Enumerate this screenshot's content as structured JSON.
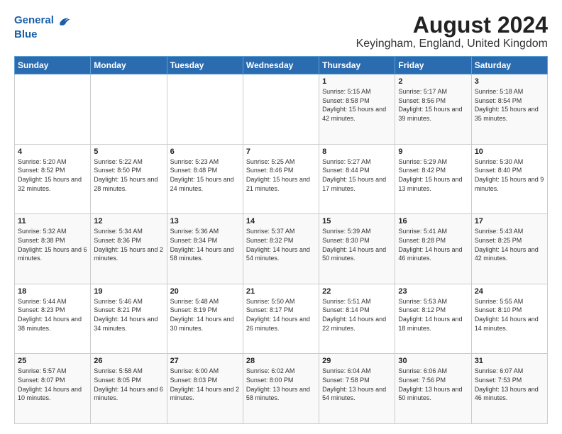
{
  "header": {
    "logo_line1": "General",
    "logo_line2": "Blue",
    "title": "August 2024",
    "subtitle": "Keyingham, England, United Kingdom"
  },
  "weekdays": [
    "Sunday",
    "Monday",
    "Tuesday",
    "Wednesday",
    "Thursday",
    "Friday",
    "Saturday"
  ],
  "weeks": [
    [
      {
        "day": "",
        "sunrise": "",
        "sunset": "",
        "daylight": ""
      },
      {
        "day": "",
        "sunrise": "",
        "sunset": "",
        "daylight": ""
      },
      {
        "day": "",
        "sunrise": "",
        "sunset": "",
        "daylight": ""
      },
      {
        "day": "",
        "sunrise": "",
        "sunset": "",
        "daylight": ""
      },
      {
        "day": "1",
        "sunrise": "Sunrise: 5:15 AM",
        "sunset": "Sunset: 8:58 PM",
        "daylight": "Daylight: 15 hours and 42 minutes."
      },
      {
        "day": "2",
        "sunrise": "Sunrise: 5:17 AM",
        "sunset": "Sunset: 8:56 PM",
        "daylight": "Daylight: 15 hours and 39 minutes."
      },
      {
        "day": "3",
        "sunrise": "Sunrise: 5:18 AM",
        "sunset": "Sunset: 8:54 PM",
        "daylight": "Daylight: 15 hours and 35 minutes."
      }
    ],
    [
      {
        "day": "4",
        "sunrise": "Sunrise: 5:20 AM",
        "sunset": "Sunset: 8:52 PM",
        "daylight": "Daylight: 15 hours and 32 minutes."
      },
      {
        "day": "5",
        "sunrise": "Sunrise: 5:22 AM",
        "sunset": "Sunset: 8:50 PM",
        "daylight": "Daylight: 15 hours and 28 minutes."
      },
      {
        "day": "6",
        "sunrise": "Sunrise: 5:23 AM",
        "sunset": "Sunset: 8:48 PM",
        "daylight": "Daylight: 15 hours and 24 minutes."
      },
      {
        "day": "7",
        "sunrise": "Sunrise: 5:25 AM",
        "sunset": "Sunset: 8:46 PM",
        "daylight": "Daylight: 15 hours and 21 minutes."
      },
      {
        "day": "8",
        "sunrise": "Sunrise: 5:27 AM",
        "sunset": "Sunset: 8:44 PM",
        "daylight": "Daylight: 15 hours and 17 minutes."
      },
      {
        "day": "9",
        "sunrise": "Sunrise: 5:29 AM",
        "sunset": "Sunset: 8:42 PM",
        "daylight": "Daylight: 15 hours and 13 minutes."
      },
      {
        "day": "10",
        "sunrise": "Sunrise: 5:30 AM",
        "sunset": "Sunset: 8:40 PM",
        "daylight": "Daylight: 15 hours and 9 minutes."
      }
    ],
    [
      {
        "day": "11",
        "sunrise": "Sunrise: 5:32 AM",
        "sunset": "Sunset: 8:38 PM",
        "daylight": "Daylight: 15 hours and 6 minutes."
      },
      {
        "day": "12",
        "sunrise": "Sunrise: 5:34 AM",
        "sunset": "Sunset: 8:36 PM",
        "daylight": "Daylight: 15 hours and 2 minutes."
      },
      {
        "day": "13",
        "sunrise": "Sunrise: 5:36 AM",
        "sunset": "Sunset: 8:34 PM",
        "daylight": "Daylight: 14 hours and 58 minutes."
      },
      {
        "day": "14",
        "sunrise": "Sunrise: 5:37 AM",
        "sunset": "Sunset: 8:32 PM",
        "daylight": "Daylight: 14 hours and 54 minutes."
      },
      {
        "day": "15",
        "sunrise": "Sunrise: 5:39 AM",
        "sunset": "Sunset: 8:30 PM",
        "daylight": "Daylight: 14 hours and 50 minutes."
      },
      {
        "day": "16",
        "sunrise": "Sunrise: 5:41 AM",
        "sunset": "Sunset: 8:28 PM",
        "daylight": "Daylight: 14 hours and 46 minutes."
      },
      {
        "day": "17",
        "sunrise": "Sunrise: 5:43 AM",
        "sunset": "Sunset: 8:25 PM",
        "daylight": "Daylight: 14 hours and 42 minutes."
      }
    ],
    [
      {
        "day": "18",
        "sunrise": "Sunrise: 5:44 AM",
        "sunset": "Sunset: 8:23 PM",
        "daylight": "Daylight: 14 hours and 38 minutes."
      },
      {
        "day": "19",
        "sunrise": "Sunrise: 5:46 AM",
        "sunset": "Sunset: 8:21 PM",
        "daylight": "Daylight: 14 hours and 34 minutes."
      },
      {
        "day": "20",
        "sunrise": "Sunrise: 5:48 AM",
        "sunset": "Sunset: 8:19 PM",
        "daylight": "Daylight: 14 hours and 30 minutes."
      },
      {
        "day": "21",
        "sunrise": "Sunrise: 5:50 AM",
        "sunset": "Sunset: 8:17 PM",
        "daylight": "Daylight: 14 hours and 26 minutes."
      },
      {
        "day": "22",
        "sunrise": "Sunrise: 5:51 AM",
        "sunset": "Sunset: 8:14 PM",
        "daylight": "Daylight: 14 hours and 22 minutes."
      },
      {
        "day": "23",
        "sunrise": "Sunrise: 5:53 AM",
        "sunset": "Sunset: 8:12 PM",
        "daylight": "Daylight: 14 hours and 18 minutes."
      },
      {
        "day": "24",
        "sunrise": "Sunrise: 5:55 AM",
        "sunset": "Sunset: 8:10 PM",
        "daylight": "Daylight: 14 hours and 14 minutes."
      }
    ],
    [
      {
        "day": "25",
        "sunrise": "Sunrise: 5:57 AM",
        "sunset": "Sunset: 8:07 PM",
        "daylight": "Daylight: 14 hours and 10 minutes."
      },
      {
        "day": "26",
        "sunrise": "Sunrise: 5:58 AM",
        "sunset": "Sunset: 8:05 PM",
        "daylight": "Daylight: 14 hours and 6 minutes."
      },
      {
        "day": "27",
        "sunrise": "Sunrise: 6:00 AM",
        "sunset": "Sunset: 8:03 PM",
        "daylight": "Daylight: 14 hours and 2 minutes."
      },
      {
        "day": "28",
        "sunrise": "Sunrise: 6:02 AM",
        "sunset": "Sunset: 8:00 PM",
        "daylight": "Daylight: 13 hours and 58 minutes."
      },
      {
        "day": "29",
        "sunrise": "Sunrise: 6:04 AM",
        "sunset": "Sunset: 7:58 PM",
        "daylight": "Daylight: 13 hours and 54 minutes."
      },
      {
        "day": "30",
        "sunrise": "Sunrise: 6:06 AM",
        "sunset": "Sunset: 7:56 PM",
        "daylight": "Daylight: 13 hours and 50 minutes."
      },
      {
        "day": "31",
        "sunrise": "Sunrise: 6:07 AM",
        "sunset": "Sunset: 7:53 PM",
        "daylight": "Daylight: 13 hours and 46 minutes."
      }
    ]
  ]
}
